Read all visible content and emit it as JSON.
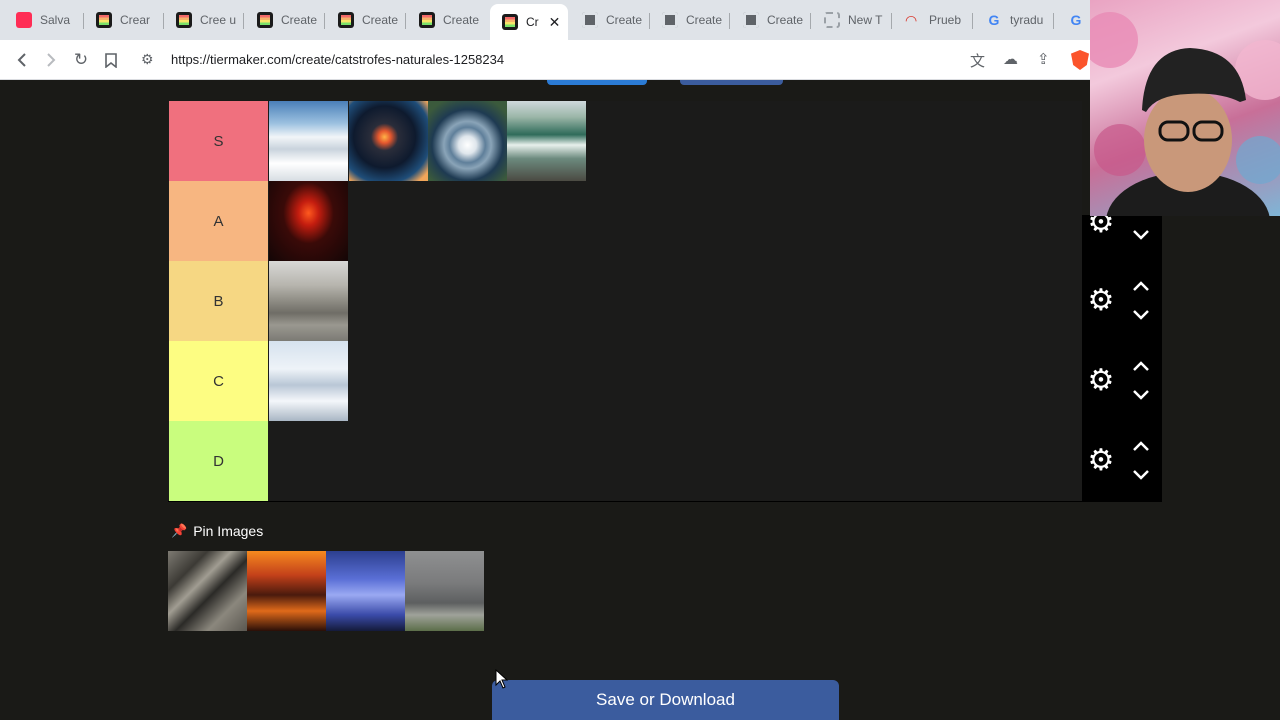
{
  "browser": {
    "tabs": [
      {
        "label": "Salva",
        "icon": "youtube-icon"
      },
      {
        "label": "Crear",
        "icon": "tiermaker-icon"
      },
      {
        "label": "Cree u",
        "icon": "tiermaker-icon"
      },
      {
        "label": "Create",
        "icon": "tiermaker-icon"
      },
      {
        "label": "Create",
        "icon": "tiermaker-icon"
      },
      {
        "label": "Create",
        "icon": "tiermaker-icon"
      },
      {
        "label": "Cr",
        "icon": "tiermaker-icon",
        "active": true
      },
      {
        "label": "Create",
        "icon": "chrome-ext-icon"
      },
      {
        "label": "Create",
        "icon": "chrome-ext-icon"
      },
      {
        "label": "Create",
        "icon": "chrome-ext-icon"
      },
      {
        "label": "New T",
        "icon": "loading-icon"
      },
      {
        "label": "Prueb",
        "icon": "speedometer-icon"
      },
      {
        "label": "tyradu",
        "icon": "google-icon"
      },
      {
        "label": "",
        "icon": "google-icon"
      }
    ],
    "url": "https://tiermaker.com/create/catstrofes-naturales-1258234"
  },
  "tierlist": {
    "rows": [
      {
        "label": "S",
        "color": "#f0707e",
        "items": [
          "avalanche",
          "meteor",
          "hurricane",
          "tsunami"
        ]
      },
      {
        "label": "A",
        "color": "#f7b681",
        "items": [
          "volcano"
        ]
      },
      {
        "label": "B",
        "color": "#f6d783",
        "items": [
          "flood"
        ]
      },
      {
        "label": "C",
        "color": "#fdfd82",
        "items": [
          "snowstorm"
        ]
      },
      {
        "label": "D",
        "color": "#c9fd7e",
        "items": []
      }
    ]
  },
  "pin": {
    "title": "Pin Images",
    "items": [
      "earthquake",
      "wildfire",
      "lightning-storm",
      "tornado"
    ]
  },
  "save_button": "Save or Download"
}
